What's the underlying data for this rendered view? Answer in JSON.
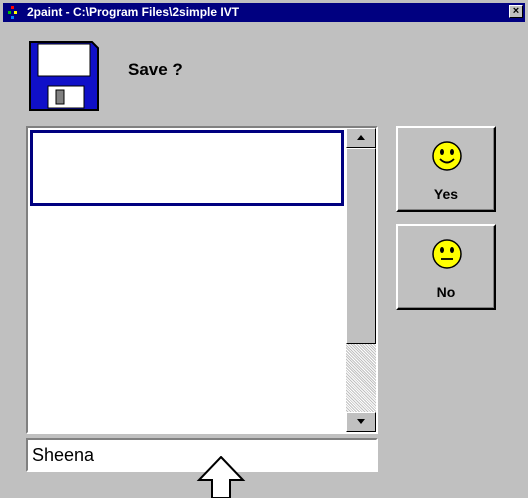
{
  "window": {
    "title": "2paint - C:\\Program Files\\2simple IVT",
    "close_glyph": "×"
  },
  "dialog": {
    "prompt": "Save ?",
    "icon": "floppy-disk-icon"
  },
  "file_list": {
    "items": [
      ""
    ],
    "selected_index": 0
  },
  "filename": {
    "value": "Sheena"
  },
  "buttons": {
    "yes": {
      "label": "Yes",
      "icon": "smiley-happy-icon"
    },
    "no": {
      "label": "No",
      "icon": "smiley-neutral-icon"
    }
  },
  "colors": {
    "titlebar": "#000080",
    "face": "#c0c0c0",
    "disk": "#1010c8",
    "smiley": "#ffff00",
    "selection_border": "#000080"
  }
}
